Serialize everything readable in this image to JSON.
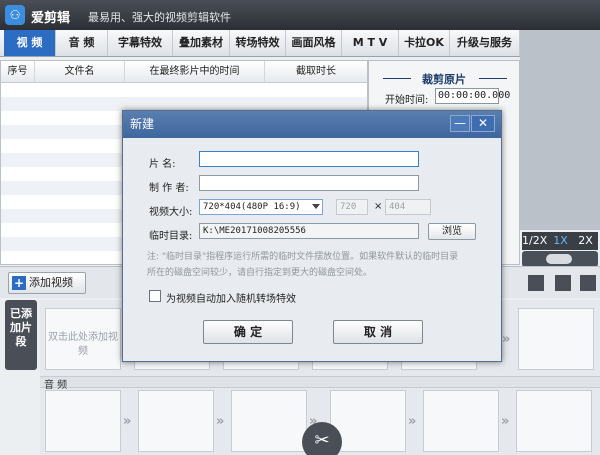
{
  "app": {
    "name": "爱剪辑",
    "logo_glyph": "⚇",
    "slogan": "最易用、强大的视频剪辑软件",
    "accent": "#2c6dc3"
  },
  "tabs": [
    {
      "label": "视 频",
      "active": true
    },
    {
      "label": "音 频"
    },
    {
      "label": "字幕特效"
    },
    {
      "label": "叠加素材"
    },
    {
      "label": "转场特效"
    },
    {
      "label": "画面风格"
    },
    {
      "label": "M T V"
    },
    {
      "label": "卡拉OK"
    },
    {
      "label": "升级与服务"
    }
  ],
  "file_table": {
    "headers": [
      "序号",
      "文件名",
      "在最终影片中的时间",
      "截取时长"
    ]
  },
  "trim_panel": {
    "title": "裁剪原片",
    "start_label": "开始时间:",
    "start_value": "00:00:00.000"
  },
  "preview": {
    "speeds": [
      "1/2X",
      "1X",
      "2X"
    ],
    "selected_speed": "1X"
  },
  "toolbar": {
    "add_video": "添加视频",
    "add_icon": "+"
  },
  "timeline": {
    "side_label": "已添加片段",
    "first_clip": "双击此处添加视频",
    "audio_label": "音 频",
    "arrow_glyph": "»",
    "cut_glyph": "✂"
  },
  "dialog": {
    "title": "新建",
    "min_glyph": "—",
    "close_glyph": "✕",
    "name_label": "片  名:",
    "name_value": "",
    "author_label": "制 作 者:",
    "author_value": "",
    "size_label": "视频大小:",
    "size_value": "720*404(480P 16:9)",
    "width_value": "720",
    "times_glyph": "×",
    "height_value": "404",
    "tempdir_label": "临时目录:",
    "tempdir_value": "K:\\ME20171008205556",
    "browse": "浏览",
    "note": "注: \"临时目录\"指程序运行所需的临时文件摆放位置。如果软件默认的临时目录所在的磁盘空间较少，请自行指定到更大的磁盘空间处。",
    "checkbox_label": "为视频自动加入随机转场特效",
    "checkbox_checked": false,
    "ok": "确 定",
    "cancel": "取 消"
  }
}
